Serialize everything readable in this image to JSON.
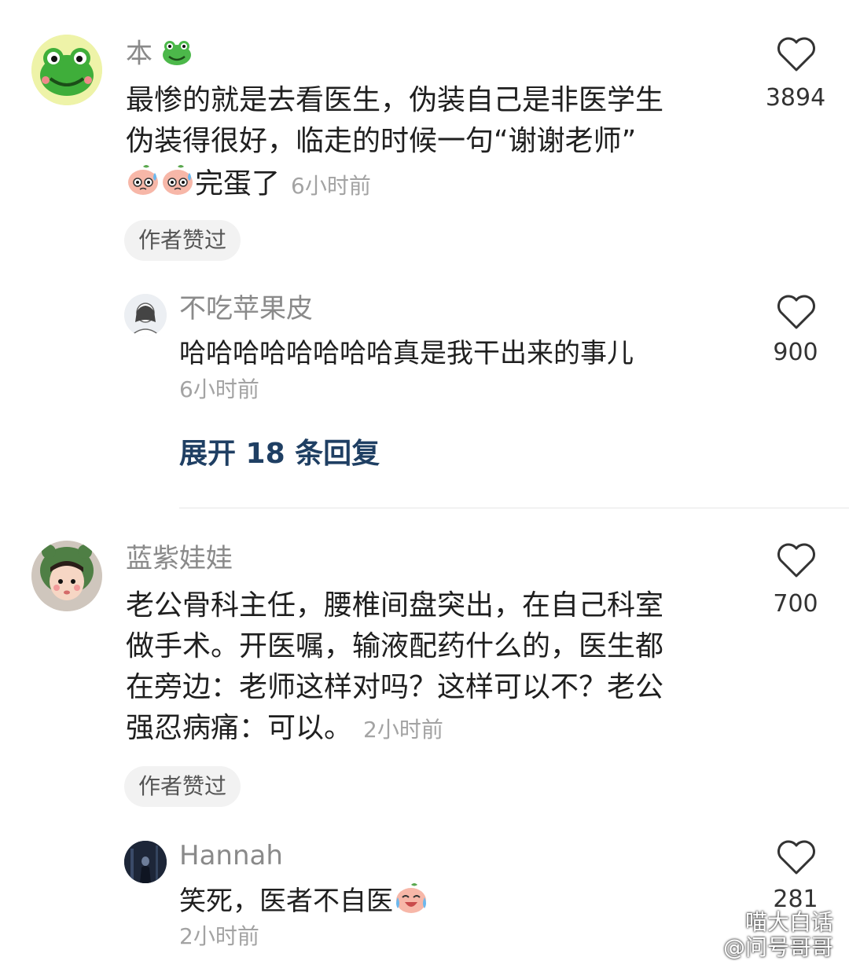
{
  "comments": [
    {
      "username": "本",
      "text_lines": [
        "最惨的就是去看医生，伪装自己是非医学生",
        "伪装得很好，临走的时候一句“谢谢老师”"
      ],
      "text_tail": "完蛋了",
      "time": "6小时前",
      "likes": "3894",
      "badge": "作者赞过",
      "reply": {
        "username": "不吃苹果皮",
        "text": "哈哈哈哈哈哈哈哈真是我干出来的事儿",
        "time": "6小时前",
        "likes": "900"
      },
      "expand_label": "展开 18 条回复"
    },
    {
      "username": "蓝紫娃娃",
      "text_lines": [
        "老公骨科主任，腰椎间盘突出，在自己科室",
        "做手术。开医嘱，输液配药什么的，医生都",
        "在旁边：老师这样对吗？这样可以不？老公"
      ],
      "text_tail": "强忍病痛：可以。",
      "time": "2小时前",
      "likes": "700",
      "badge": "作者赞过",
      "reply": {
        "username": "Hannah",
        "text": "笑死，医者不自医",
        "time": "2小时前",
        "likes": "281"
      }
    }
  ],
  "watermark": {
    "line1": "喵大白话",
    "line2": "@问号哥哥"
  },
  "icons": {
    "like": "heart-outline-icon",
    "frog": "frog-face-icon",
    "sweat_face": "sweating-peach-face-icon",
    "cry_laugh": "crying-laughing-peach-icon"
  },
  "colors": {
    "username": "#8a8a8a",
    "time": "#a3a3a3",
    "expand": "#1f3f63",
    "badge_bg": "#f2f2f2"
  }
}
